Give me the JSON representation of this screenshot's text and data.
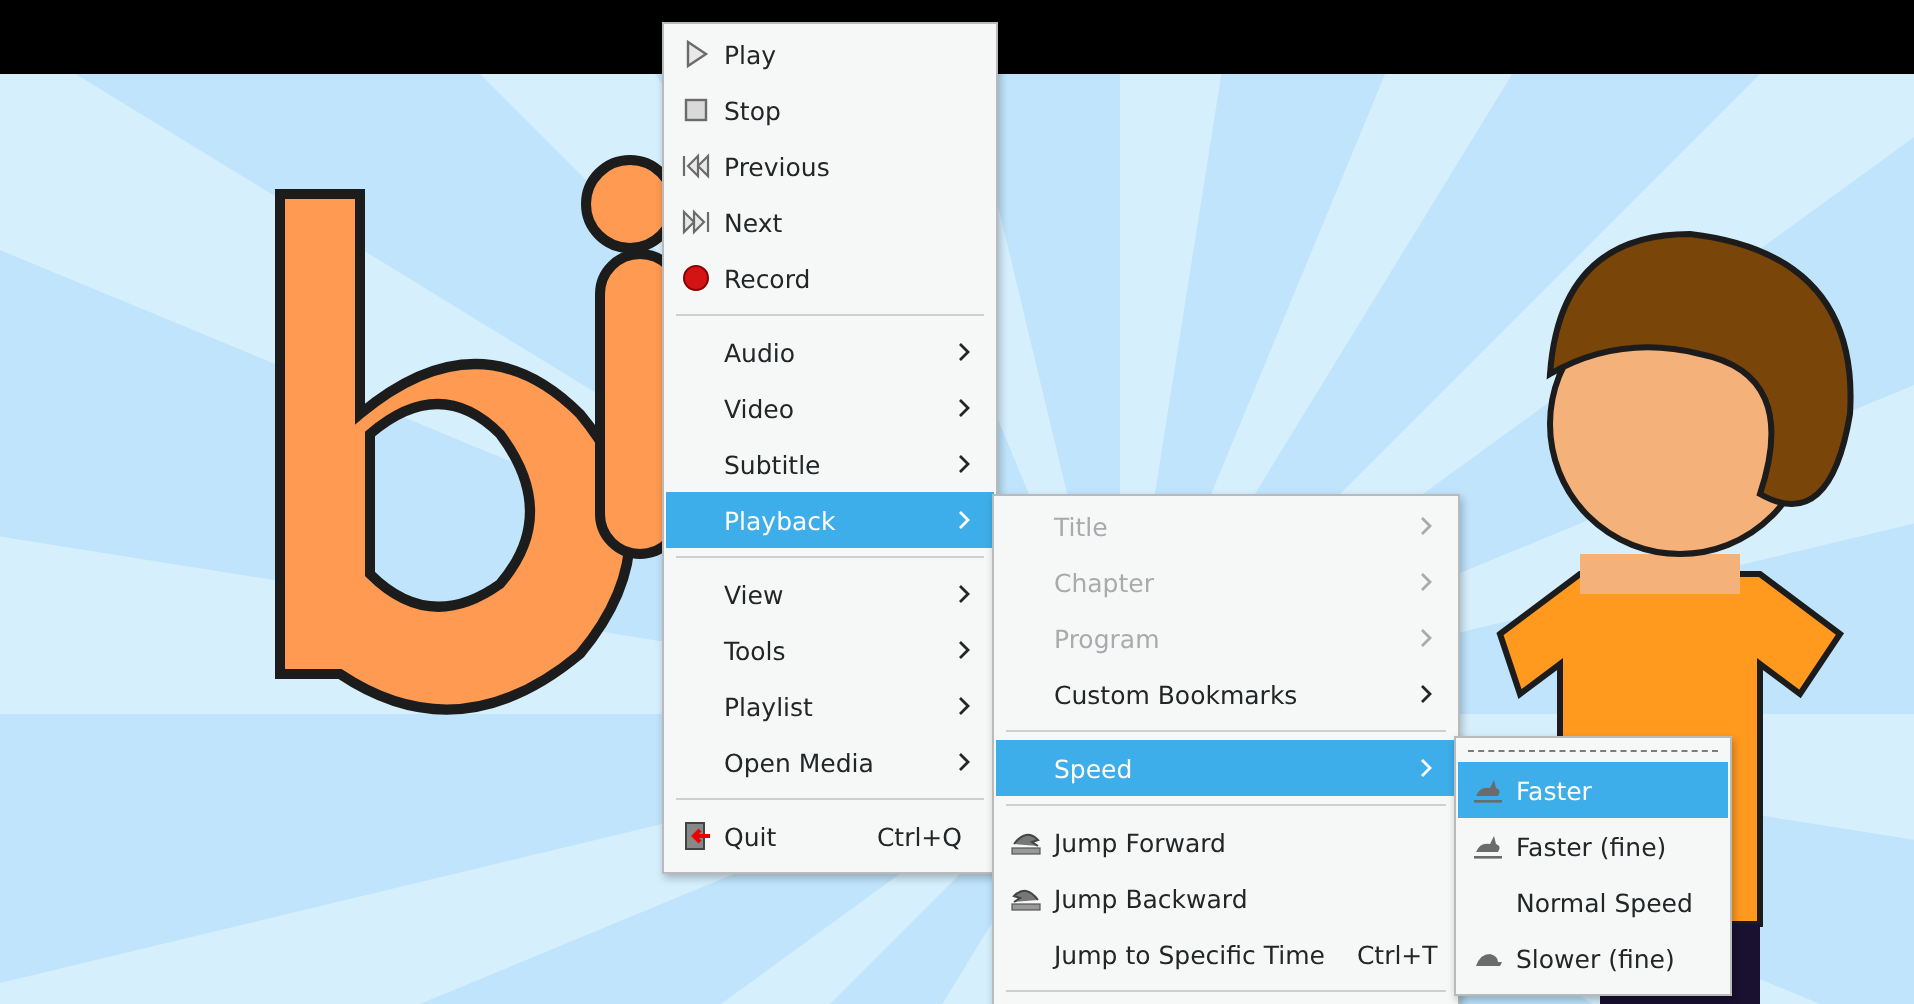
{
  "menus": [
    {
      "items": [
        {
          "kind": "play",
          "label": "Play",
          "disabled": false,
          "selected": false
        },
        {
          "kind": "stop",
          "label": "Stop",
          "disabled": false,
          "selected": false
        },
        {
          "kind": "previous",
          "label": "Previous",
          "disabled": false,
          "selected": false
        },
        {
          "kind": "next",
          "label": "Next",
          "disabled": false,
          "selected": false
        },
        {
          "kind": "record",
          "label": "Record",
          "disabled": false,
          "selected": false
        },
        {
          "kind": "separator"
        },
        {
          "kind": "submenu",
          "label": "Audio",
          "disabled": false,
          "selected": false
        },
        {
          "kind": "submenu",
          "label": "Video",
          "disabled": false,
          "selected": false
        },
        {
          "kind": "submenu",
          "label": "Subtitle",
          "disabled": false,
          "selected": false
        },
        {
          "kind": "submenu",
          "label": "Playback",
          "disabled": false,
          "selected": true
        },
        {
          "kind": "separator"
        },
        {
          "kind": "submenu",
          "label": "View",
          "disabled": false,
          "selected": false
        },
        {
          "kind": "submenu",
          "label": "Tools",
          "disabled": false,
          "selected": false
        },
        {
          "kind": "submenu",
          "label": "Playlist",
          "disabled": false,
          "selected": false
        },
        {
          "kind": "submenu",
          "label": "Open Media",
          "disabled": false,
          "selected": false
        },
        {
          "kind": "separator"
        },
        {
          "kind": "quit",
          "label": "Quit",
          "shortcut": "Ctrl+Q",
          "disabled": false,
          "selected": false
        }
      ]
    },
    {
      "items": [
        {
          "kind": "submenu",
          "label": "Title",
          "disabled": true,
          "selected": false
        },
        {
          "kind": "submenu",
          "label": "Chapter",
          "disabled": true,
          "selected": false
        },
        {
          "kind": "submenu",
          "label": "Program",
          "disabled": true,
          "selected": false
        },
        {
          "kind": "submenu",
          "label": "Custom Bookmarks",
          "disabled": false,
          "selected": false
        },
        {
          "kind": "separator"
        },
        {
          "kind": "submenu",
          "label": "Speed",
          "disabled": false,
          "selected": true
        },
        {
          "kind": "separator"
        },
        {
          "kind": "forward",
          "label": "Jump Forward",
          "disabled": false,
          "selected": false
        },
        {
          "kind": "backward",
          "label": "Jump Backward",
          "disabled": false,
          "selected": false
        },
        {
          "kind": "plain",
          "label": "Jump to Specific Time",
          "shortcut": "Ctrl+T",
          "disabled": false,
          "selected": false
        },
        {
          "kind": "separator"
        }
      ]
    },
    {
      "items": [
        {
          "kind": "tearoff"
        },
        {
          "kind": "rabbit",
          "label": "Faster",
          "disabled": false,
          "selected": true
        },
        {
          "kind": "rabbit",
          "label": "Faster (fine)",
          "disabled": false,
          "selected": false
        },
        {
          "kind": "plain",
          "label": "Normal Speed",
          "disabled": false,
          "selected": false
        },
        {
          "kind": "turtle",
          "label": "Slower (fine)",
          "disabled": false,
          "selected": false
        }
      ]
    }
  ]
}
